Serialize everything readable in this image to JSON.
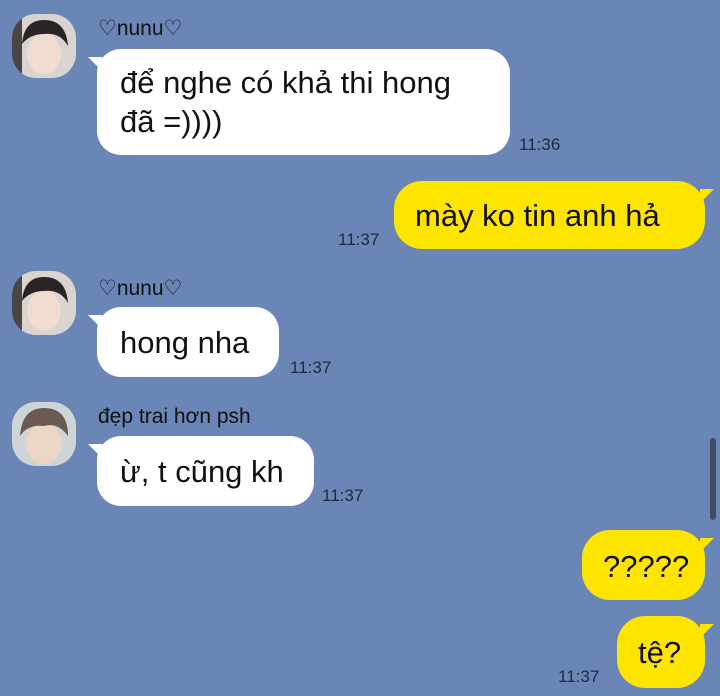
{
  "messages": [
    {
      "sender": "♡nunu♡",
      "text_line1": "để nghe có khả thi hong",
      "text_line2": "đã =))))",
      "time": "11:36"
    },
    {
      "text": "mày ko tin anh hả",
      "time": "11:37"
    },
    {
      "sender": "♡nunu♡",
      "text": "hong nha",
      "time": "11:37"
    },
    {
      "sender": "đẹp trai hơn psh",
      "text": "ừ, t cũng kh",
      "time": "11:37"
    },
    {
      "text": "?????"
    },
    {
      "text": "tệ?",
      "time": "11:37"
    }
  ],
  "colors": {
    "background": "#6a86b7",
    "incoming_bubble": "#ffffff",
    "outgoing_bubble": "#fee500"
  }
}
